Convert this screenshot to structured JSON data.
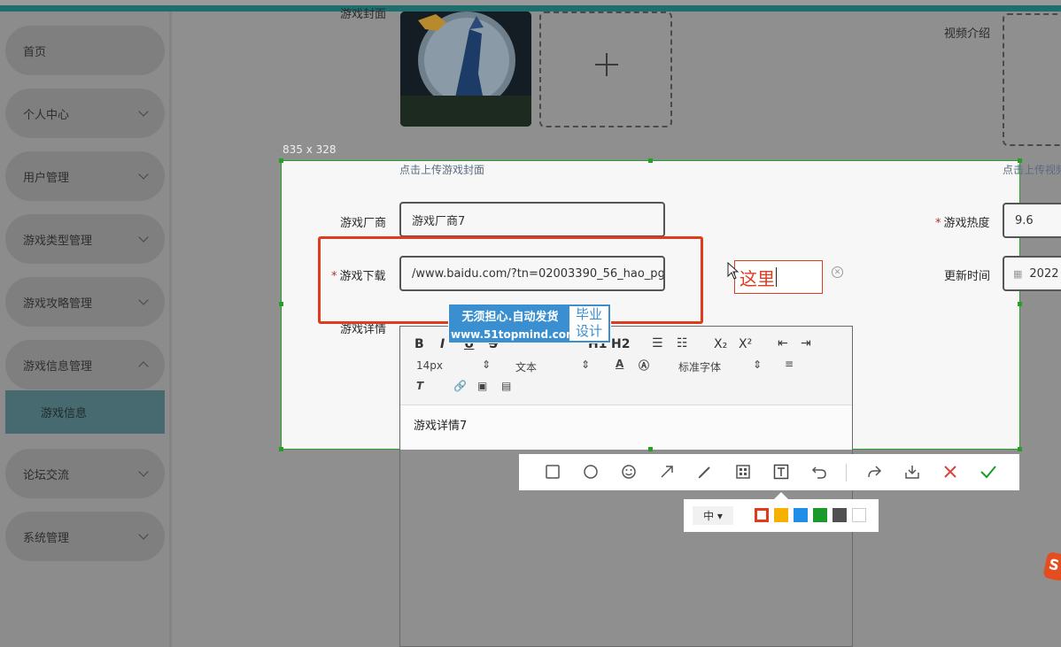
{
  "sidebar": {
    "items": [
      {
        "label": "首页"
      },
      {
        "label": "个人中心"
      },
      {
        "label": "用户管理"
      },
      {
        "label": "游戏类型管理"
      },
      {
        "label": "游戏攻略管理"
      },
      {
        "label": "游戏信息管理"
      },
      {
        "label": "论坛交流"
      },
      {
        "label": "系统管理"
      }
    ],
    "active_sub": "游戏信息"
  },
  "form": {
    "cover_label": "游戏封面",
    "cover_hint": "点击上传游戏封面",
    "video_label": "视频介绍",
    "video_hint": "点击上传视频",
    "vendor_label": "游戏厂商",
    "vendor_value": "游戏厂商7",
    "download_label": "游戏下载",
    "download_value": "/www.baidu.com/?tn=02003390_56_hao_pg",
    "detail_label": "游戏详情",
    "heat_label": "游戏热度",
    "heat_value": "9.6",
    "update_label": "更新时间",
    "update_value": "2022"
  },
  "editor": {
    "font_size": "14px",
    "paragraph": "文本",
    "font_family": "标准字体",
    "content": "游戏详情7",
    "buttons": [
      "B",
      "I",
      "U",
      "S",
      "H1",
      "H2",
      "X₂",
      "X²"
    ]
  },
  "capture": {
    "size_label": "835 x 328",
    "text_annotation": "这里",
    "stroke_size": "中 ▾",
    "colors": [
      "#e03a1f",
      "#f5b000",
      "#1e8ee9",
      "#1a9a2a",
      "#505050",
      "#ffffff"
    ]
  },
  "watermark": {
    "line1": "无须担心.自动发货",
    "line2": "www.51topmind.com",
    "badge": "毕业 设计"
  }
}
